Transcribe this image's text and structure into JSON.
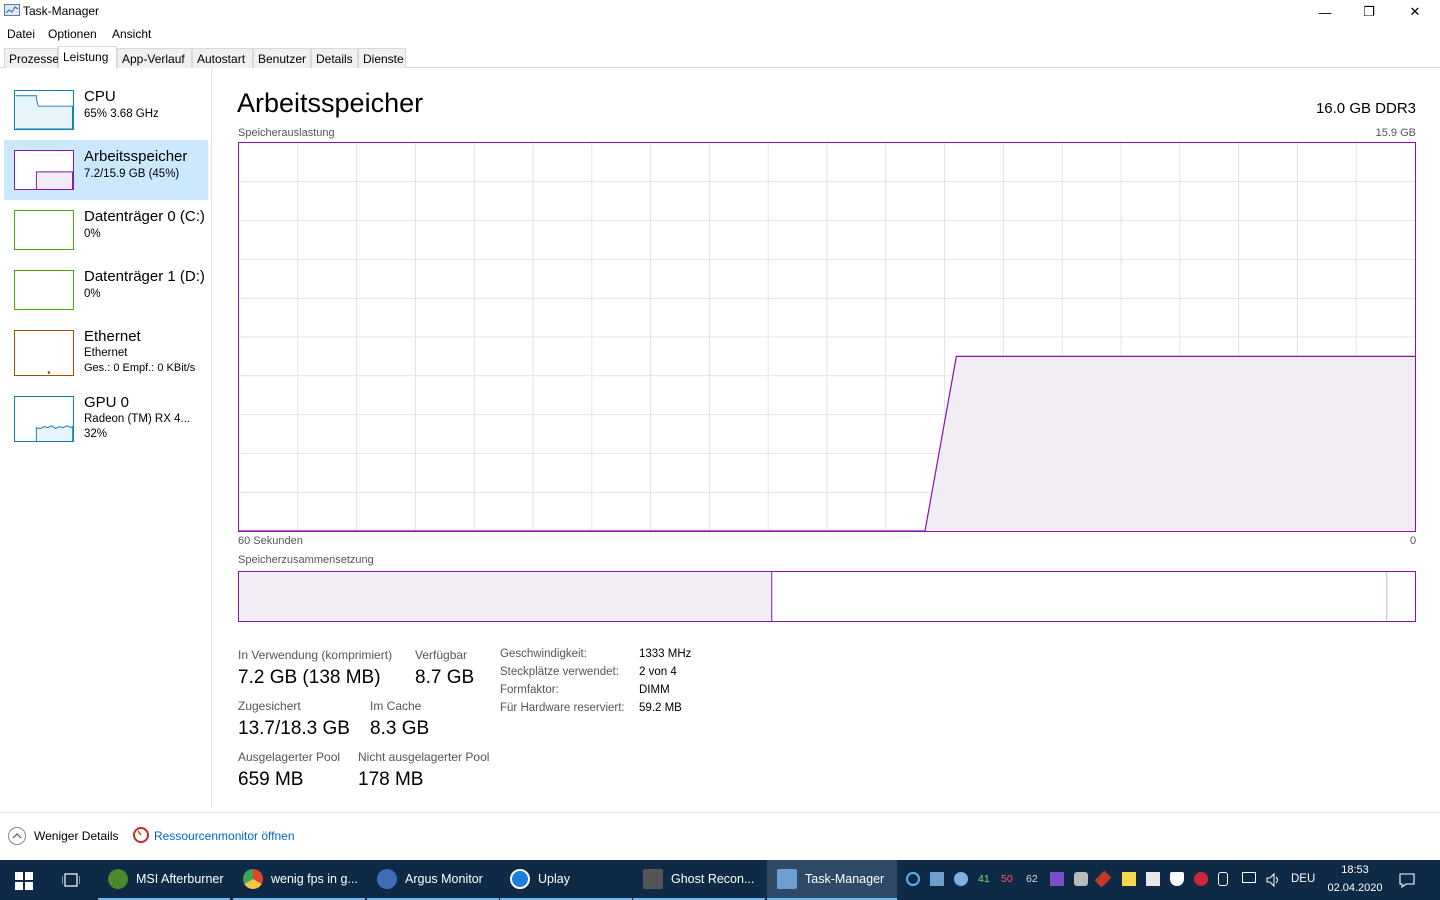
{
  "window": {
    "title": "Task-Manager",
    "minimize_glyph": "—",
    "maximize_glyph": "❐",
    "close_glyph": "✕"
  },
  "menu": [
    "Datei",
    "Optionen",
    "Ansicht"
  ],
  "tabs": [
    {
      "label": "Prozesse",
      "active": false
    },
    {
      "label": "Leistung",
      "active": true
    },
    {
      "label": "App-Verlauf",
      "active": false
    },
    {
      "label": "Autostart",
      "active": false
    },
    {
      "label": "Benutzer",
      "active": false
    },
    {
      "label": "Details",
      "active": false
    },
    {
      "label": "Dienste",
      "active": false
    }
  ],
  "sidebar": {
    "items": [
      {
        "title": "CPU",
        "sub1": "65% 3.68 GHz",
        "sub2": "",
        "color": "#117dbb",
        "selected": false
      },
      {
        "title": "Arbeitsspeicher",
        "sub1": "7.2/15.9 GB (45%)",
        "sub2": "",
        "color": "#8b12ae",
        "selected": true
      },
      {
        "title": "Datenträger 0 (C:)",
        "sub1": "0%",
        "sub2": "",
        "color": "#4da60c",
        "selected": false
      },
      {
        "title": "Datenträger 1 (D:)",
        "sub1": "0%",
        "sub2": "",
        "color": "#4da60c",
        "selected": false
      },
      {
        "title": "Ethernet",
        "sub1": "Ethernet",
        "sub2": "Ges.: 0 Empf.: 0 KBit/s",
        "color": "#a74f01",
        "selected": false
      },
      {
        "title": "GPU 0",
        "sub1": "Radeon (TM) RX 4...",
        "sub2": "32%",
        "color": "#117dbb",
        "selected": false
      }
    ]
  },
  "main": {
    "title": "Arbeitsspeicher",
    "spec": "16.0 GB DDR3",
    "graph_label": "Speicherauslastung",
    "graph_max": "15.9 GB",
    "graph_time": "60 Sekunden",
    "graph_min": "0",
    "composition_label": "Speicherzusammensetzung",
    "stats": {
      "in_use_label": "In Verwendung (komprimiert)",
      "in_use_value": "7.2 GB (138 MB)",
      "available_label": "Verfügbar",
      "available_value": "8.7 GB",
      "committed_label": "Zugesichert",
      "committed_value": "13.7/18.3 GB",
      "cached_label": "Im Cache",
      "cached_value": "8.3 GB",
      "paged_label": "Ausgelagerter Pool",
      "paged_value": "659 MB",
      "nonpaged_label": "Nicht ausgelagerter Pool",
      "nonpaged_value": "178 MB"
    },
    "details": [
      {
        "label": "Geschwindigkeit:",
        "value": "1333 MHz"
      },
      {
        "label": "Steckplätze verwendet:",
        "value": "2 von 4"
      },
      {
        "label": "Formfaktor:",
        "value": "DIMM"
      },
      {
        "label": "Für Hardware reserviert:",
        "value": "59.2 MB"
      }
    ]
  },
  "chart_data": {
    "type": "area",
    "x": [
      0,
      35,
      36.6,
      39,
      60
    ],
    "values": [
      0,
      0,
      45,
      45,
      45
    ],
    "ylim": [
      0,
      100
    ],
    "xlim": [
      0,
      60
    ],
    "color": "#8b12ae"
  },
  "composition": {
    "in_use_fraction": 0.453,
    "modified_fraction": 0.0,
    "standby_fraction": 0.523,
    "free_fraction": 0.024
  },
  "footer": {
    "fewer_details": "Weniger Details",
    "resource_monitor": "Ressourcenmonitor öffnen"
  },
  "taskbar": {
    "apps": [
      {
        "label": "MSI Afterburner",
        "color": "#4b8a2b"
      },
      {
        "label": "wenig fps in g...",
        "color": "#e0452b"
      },
      {
        "label": "Argus Monitor",
        "color": "#3d6fb6"
      },
      {
        "label": "Uplay",
        "color": "#1a7fd6"
      },
      {
        "label": "Ghost Recon...",
        "color": "#555555"
      },
      {
        "label": "Task-Manager",
        "color": "#6a9fd0"
      }
    ],
    "tray_numbers": [
      "41",
      "50",
      "62"
    ],
    "language": "DEU",
    "time": "18:53",
    "date": "02.04.2020"
  }
}
